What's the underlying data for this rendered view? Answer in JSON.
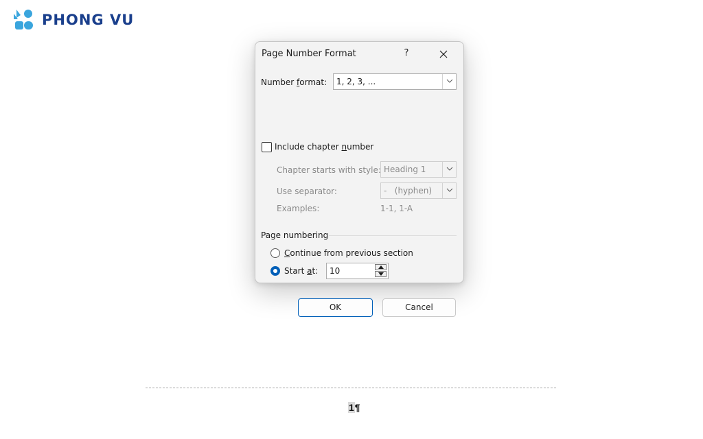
{
  "brand": {
    "name": "PHONG VU",
    "text_color": "#1a3f8c",
    "mark_color": "#3aa5dd"
  },
  "dialog": {
    "title": "Page Number Format",
    "help_label": "?",
    "close_icon": "close-icon",
    "number_format": {
      "label_before": "Number ",
      "label_accel": "f",
      "label_after": "ormat:",
      "value": "1, 2, 3, ..."
    },
    "include_chapter": {
      "label_before": "Include chapter ",
      "label_accel": "n",
      "label_after": "umber",
      "checked": false
    },
    "chapter_style": {
      "label": "Chapter starts with style:",
      "value": "Heading 1",
      "enabled": false
    },
    "separator": {
      "label": "Use separator:",
      "value": "-   (hyphen)",
      "enabled": false
    },
    "examples": {
      "label": "Examples:",
      "value": "1-1, 1-A"
    },
    "page_numbering": {
      "group_label": "Page numbering",
      "continue_option": {
        "label_accel": "C",
        "label_after": "ontinue from previous section",
        "selected": false
      },
      "start_at_option": {
        "label_before": "Start ",
        "label_accel": "a",
        "label_after": "t:",
        "selected": true,
        "value": "10"
      }
    },
    "ok_label": "OK",
    "cancel_label": "Cancel",
    "accent_color": "#005fb8"
  },
  "document": {
    "page_number": "1",
    "pilcrow": "¶"
  }
}
